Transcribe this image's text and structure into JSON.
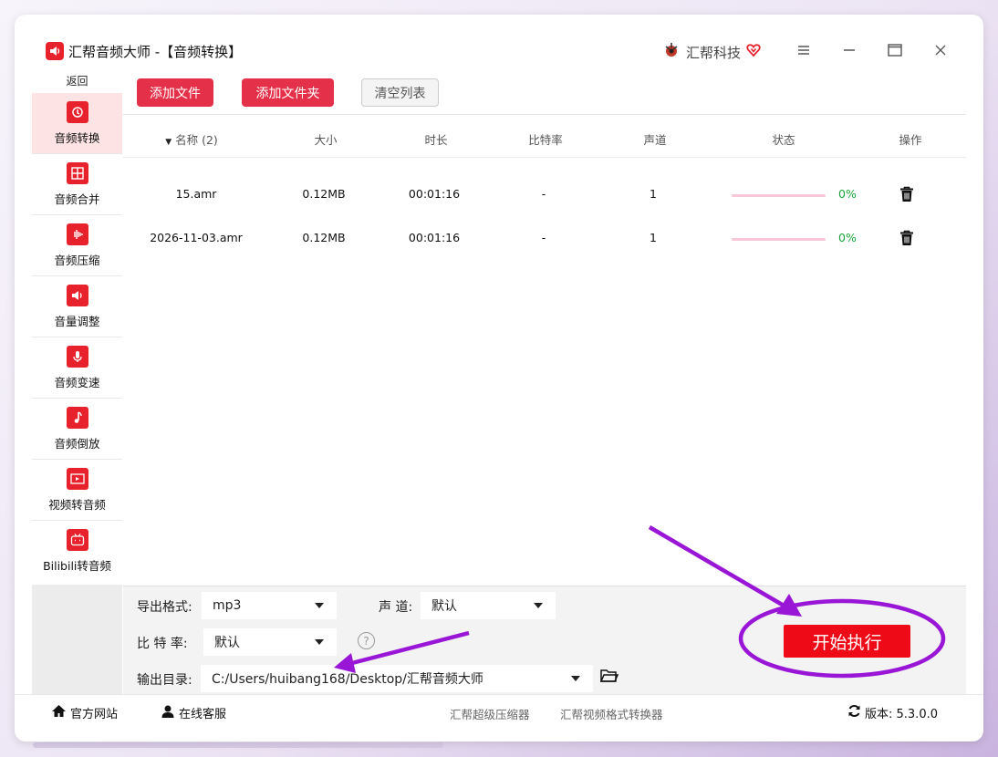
{
  "window": {
    "title": "汇帮音频大师  -【音频转换】",
    "brand": "汇帮科技"
  },
  "sidebar": {
    "back_label": "返回",
    "items": [
      {
        "label": "音频转换",
        "icon": "audio-convert-icon"
      },
      {
        "label": "音频合并",
        "icon": "audio-merge-icon"
      },
      {
        "label": "音频压缩",
        "icon": "audio-compress-icon"
      },
      {
        "label": "音量调整",
        "icon": "volume-adjust-icon"
      },
      {
        "label": "音频变速",
        "icon": "audio-speed-icon"
      },
      {
        "label": "音频倒放",
        "icon": "audio-reverse-icon"
      },
      {
        "label": "视频转音频",
        "icon": "video-to-audio-icon"
      },
      {
        "label": "Bilibili转音频",
        "icon": "bilibili-icon"
      }
    ]
  },
  "toolbar": {
    "add_file": "添加文件",
    "add_folder": "添加文件夹",
    "clear_list": "清空列表"
  },
  "table": {
    "headers": {
      "name": "名称 (2)",
      "size": "大小",
      "duration": "时长",
      "bitrate": "比特率",
      "channels": "声道",
      "status": "状态",
      "action": "操作"
    },
    "rows": [
      {
        "name": "15.amr",
        "size": "0.12MB",
        "duration": "00:01:16",
        "bitrate": "-",
        "channels": "1",
        "progress": 0,
        "progress_text": "0%"
      },
      {
        "name": "2026-11-03.amr",
        "size": "0.12MB",
        "duration": "00:01:16",
        "bitrate": "-",
        "channels": "1",
        "progress": 0,
        "progress_text": "0%"
      }
    ]
  },
  "settings": {
    "format_label": "导出格式:",
    "format_value": "mp3",
    "channel_label": "声 道:",
    "channel_value": "默认",
    "bitrate_label": "比 特 率:",
    "bitrate_value": "默认",
    "output_label": "输出目录:",
    "output_value": "C:/Users/huibang168/Desktop/汇帮音频大师",
    "start_label": "开始执行"
  },
  "statusbar": {
    "website": "官方网站",
    "support": "在线客服",
    "link1": "汇帮超级压缩器",
    "link2": "汇帮视频格式转换器",
    "version": "版本: 5.3.0.0"
  },
  "colors": {
    "accent": "#e5304a",
    "start": "#ee0a16",
    "annotation": "#9a16d6",
    "progress_ok": "#1aa33a"
  }
}
